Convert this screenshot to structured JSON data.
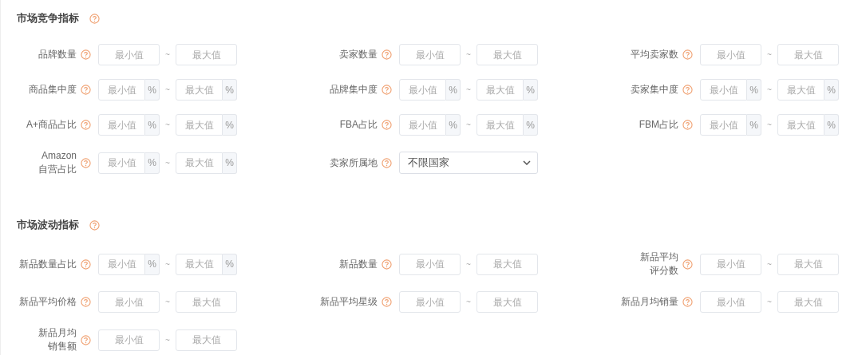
{
  "sections": [
    {
      "title": "市场竞争指标",
      "fields": [
        {
          "kind": "range",
          "label": "品牌数量",
          "min_placeholder": "最小值",
          "separator": "~",
          "max_placeholder": "最大值"
        },
        {
          "kind": "range",
          "label": "卖家数量",
          "min_placeholder": "最小值",
          "separator": "~",
          "max_placeholder": "最大值"
        },
        {
          "kind": "range",
          "label": "平均卖家数",
          "min_placeholder": "最小值",
          "separator": "~",
          "max_placeholder": "最大值"
        },
        {
          "kind": "range",
          "label": "商品集中度",
          "min_placeholder": "最小值",
          "unit": "%",
          "separator": "~",
          "max_placeholder": "最大值"
        },
        {
          "kind": "range",
          "label": "品牌集中度",
          "min_placeholder": "最小值",
          "unit": "%",
          "separator": "~",
          "max_placeholder": "最大值"
        },
        {
          "kind": "range",
          "label": "卖家集中度",
          "min_placeholder": "最小值",
          "unit": "%",
          "separator": "~",
          "max_placeholder": "最大值"
        },
        {
          "kind": "range",
          "label": "A+商品占比",
          "min_placeholder": "最小值",
          "unit": "%",
          "separator": "~",
          "max_placeholder": "最大值"
        },
        {
          "kind": "range",
          "label": "FBA占比",
          "min_placeholder": "最小值",
          "unit": "%",
          "separator": "~",
          "max_placeholder": "最大值"
        },
        {
          "kind": "range",
          "label": "FBM占比",
          "min_placeholder": "最小值",
          "unit": "%",
          "separator": "~",
          "max_placeholder": "最大值"
        },
        {
          "kind": "range",
          "label": "Amazon\n自营占比",
          "min_placeholder": "最小值",
          "unit": "%",
          "separator": "~",
          "max_placeholder": "最大值"
        },
        {
          "kind": "select",
          "label": "卖家所属地",
          "value": "不限国家"
        }
      ]
    },
    {
      "title": "市场波动指标",
      "fields": [
        {
          "kind": "range",
          "label": "新品数量占比",
          "min_placeholder": "最小值",
          "unit": "%",
          "separator": "~",
          "max_placeholder": "最大值"
        },
        {
          "kind": "range",
          "label": "新品数量",
          "min_placeholder": "最小值",
          "separator": "~",
          "max_placeholder": "最大值"
        },
        {
          "kind": "range",
          "label": "新品平均评分数",
          "min_placeholder": "最小值",
          "separator": "~",
          "max_placeholder": "最大值"
        },
        {
          "kind": "range",
          "label": "新品平均价格",
          "min_placeholder": "最小值",
          "separator": "~",
          "max_placeholder": "最大值"
        },
        {
          "kind": "range",
          "label": "新品平均星级",
          "min_placeholder": "最小值",
          "separator": "~",
          "max_placeholder": "最大值"
        },
        {
          "kind": "range",
          "label": "新品月均销量",
          "min_placeholder": "最小值",
          "separator": "~",
          "max_placeholder": "最大值"
        },
        {
          "kind": "range",
          "label": "新品月均销售额",
          "min_placeholder": "最小值",
          "separator": "~",
          "max_placeholder": "最大值"
        }
      ]
    }
  ]
}
